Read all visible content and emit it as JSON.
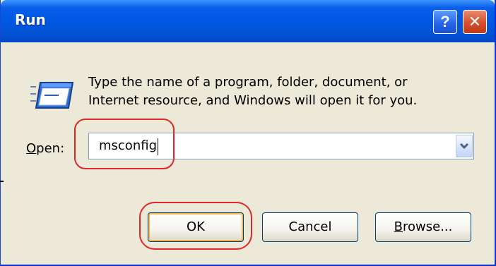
{
  "window": {
    "title": "Run"
  },
  "titlebar": {
    "buttons": [
      {
        "name": "help",
        "glyph": "?"
      },
      {
        "name": "close",
        "glyph": "✕"
      }
    ]
  },
  "description": {
    "line1": "Type the name of a program, folder, document, or",
    "line2": "Internet resource, and Windows will open it for you."
  },
  "open": {
    "label_accel": "O",
    "label_rest": "pen:",
    "value": "msconfig"
  },
  "buttons": {
    "ok": "OK",
    "cancel": "Cancel",
    "browse_accel": "B",
    "browse_rest": "rowse..."
  },
  "colors": {
    "titlebar": "#0058e6",
    "dialog_bg": "#ece9d8",
    "highlight_annotation": "#e0262a",
    "close_button": "#d4502c"
  },
  "icons": {
    "dialog_icon": "run-window-icon",
    "dropdown": "chevron-down-icon"
  }
}
